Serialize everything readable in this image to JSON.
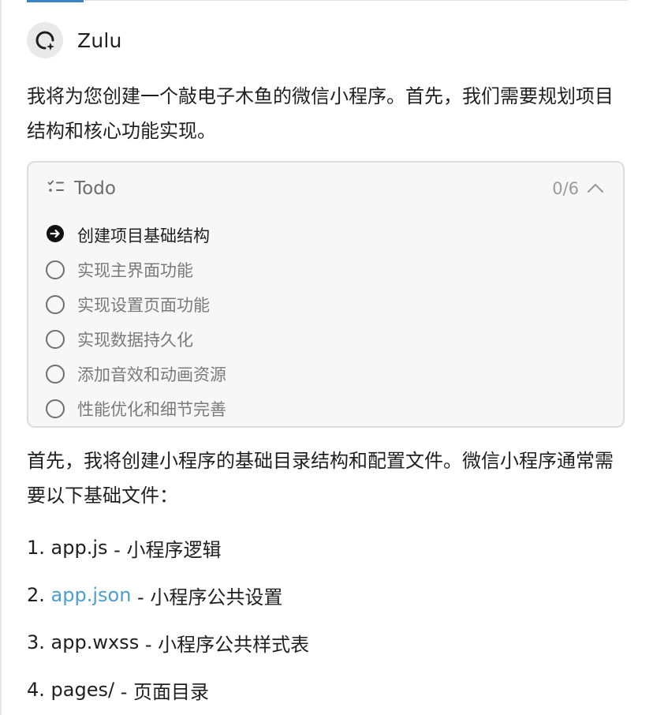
{
  "colors": {
    "link": "#4a9fd0",
    "card_bg": "#f7f7f8",
    "card_border": "#dcdcdc",
    "top_accent": "#3b82c4"
  },
  "assistant": {
    "name": "Zulu",
    "avatar_icon": "zulu-logo-icon"
  },
  "intro_text": "我将为您创建一个敲电子木鱼的微信小程序。首先，我们需要规划项目结构和核心功能实现。",
  "todo": {
    "icon": "checklist-icon",
    "title": "Todo",
    "count": "0/6",
    "collapse_icon": "chevron-up-icon",
    "items": [
      {
        "label": "创建项目基础结构",
        "state": "in-progress"
      },
      {
        "label": "实现主界面功能",
        "state": "pending"
      },
      {
        "label": "实现设置页面功能",
        "state": "pending"
      },
      {
        "label": "实现数据持久化",
        "state": "pending"
      },
      {
        "label": "添加音效和动画资源",
        "state": "pending"
      },
      {
        "label": "性能优化和细节完善",
        "state": "pending"
      }
    ]
  },
  "followup_text": "首先，我将创建小程序的基础目录结构和配置文件。微信小程序通常需要以下基础文件：",
  "file_list": [
    {
      "num": "1.",
      "name": "app.js",
      "desc": " - 小程序逻辑",
      "is_link": false
    },
    {
      "num": "2.",
      "name": "app.json",
      "desc": " - 小程序公共设置",
      "is_link": true
    },
    {
      "num": "3.",
      "name": "app.wxss",
      "desc": " - 小程序公共样式表",
      "is_link": false
    },
    {
      "num": "4.",
      "name": "pages/",
      "desc": " - 页面目录",
      "is_link": false
    }
  ]
}
